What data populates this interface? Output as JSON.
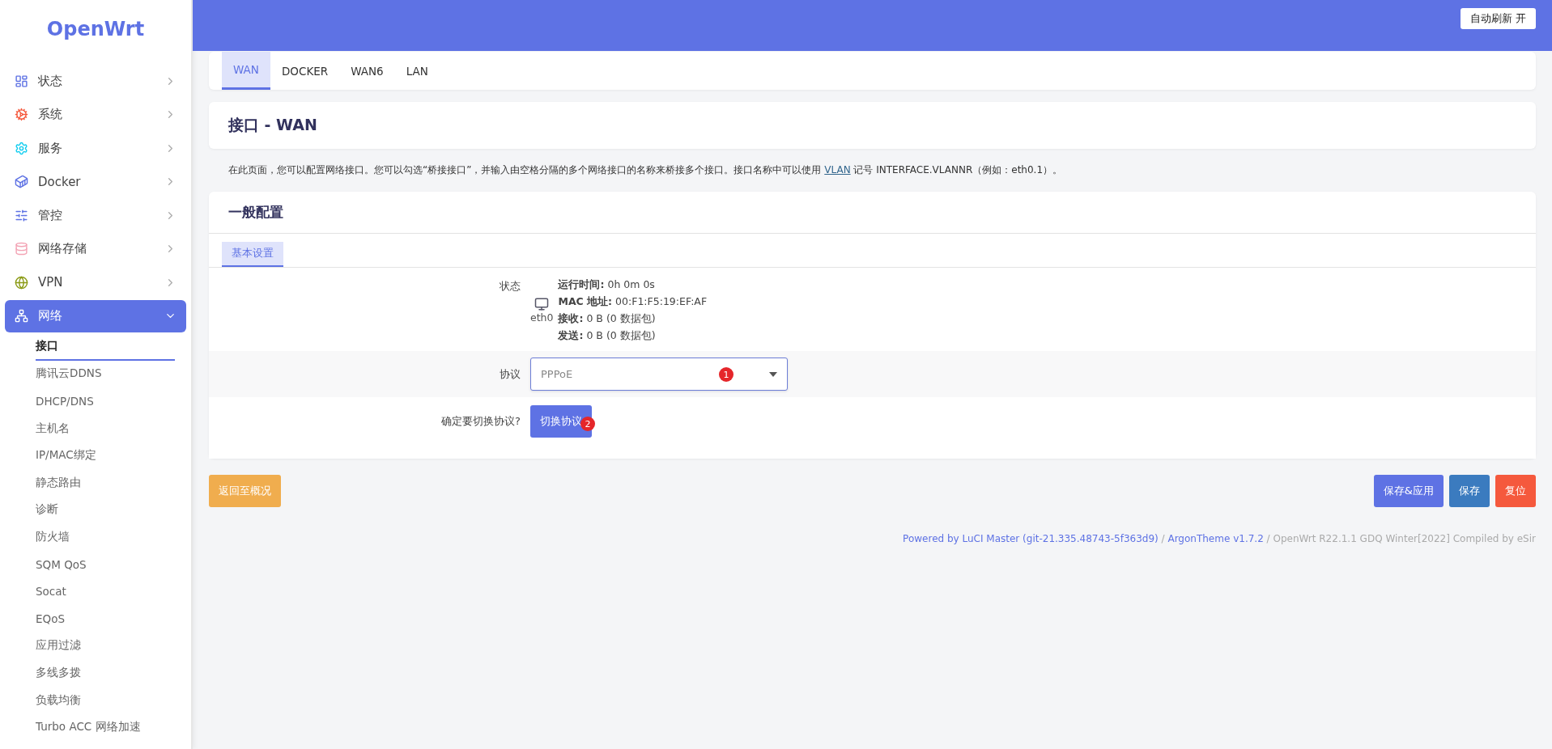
{
  "logo": "OpenWrt",
  "sidebar": {
    "items": [
      {
        "label": "状态",
        "selected": false,
        "expanded": false
      },
      {
        "label": "系统",
        "selected": false,
        "expanded": false
      },
      {
        "label": "服务",
        "selected": false,
        "expanded": false
      },
      {
        "label": "Docker",
        "selected": false,
        "expanded": false
      },
      {
        "label": "管控",
        "selected": false,
        "expanded": false
      },
      {
        "label": "网络存储",
        "selected": false,
        "expanded": false
      },
      {
        "label": "VPN",
        "selected": false,
        "expanded": false
      },
      {
        "label": "网络",
        "selected": true,
        "expanded": true,
        "children": [
          {
            "label": "接口",
            "selected": true
          },
          {
            "label": "腾讯云DDNS",
            "selected": false
          },
          {
            "label": "DHCP/DNS",
            "selected": false
          },
          {
            "label": "主机名",
            "selected": false
          },
          {
            "label": "IP/MAC绑定",
            "selected": false
          },
          {
            "label": "静态路由",
            "selected": false
          },
          {
            "label": "诊断",
            "selected": false
          },
          {
            "label": "防火墙",
            "selected": false
          },
          {
            "label": "SQM QoS",
            "selected": false
          },
          {
            "label": "Socat",
            "selected": false
          },
          {
            "label": "EQoS",
            "selected": false
          },
          {
            "label": "应用过滤",
            "selected": false
          },
          {
            "label": "多线多拨",
            "selected": false
          },
          {
            "label": "负载均衡",
            "selected": false
          },
          {
            "label": "Turbo ACC 网络加速",
            "selected": false
          }
        ]
      }
    ]
  },
  "header": {
    "refresh_button": "自动刷新 开"
  },
  "tabs": [
    {
      "label": "WAN",
      "selected": true
    },
    {
      "label": "DOCKER",
      "selected": false
    },
    {
      "label": "WAN6",
      "selected": false
    },
    {
      "label": "LAN",
      "selected": false
    }
  ],
  "page_title": "接口 - WAN",
  "description": {
    "text": "在此页面，您可以配置网络接口。您可以勾选“桥接接口”，并输入由空格分隔的多个网络接口的名称来桥接多个接口。接口名称中可以使用 ",
    "link": "VLAN",
    "after": " 记号 INTERFACE.VLANNR（例如：eth0.1）。"
  },
  "section": {
    "title": "一般配置",
    "subtabs": [
      {
        "label": "基本设置",
        "selected": true
      }
    ],
    "status": {
      "label": "状态",
      "device": "eth0",
      "lines": [
        {
          "key": "运行时间:",
          "value": " 0h 0m 0s"
        },
        {
          "key": "MAC 地址:",
          "value": " 00:F1:F5:19:EF:AF"
        },
        {
          "key": "接收:",
          "value": " 0 B (0 数据包)"
        },
        {
          "key": "发送:",
          "value": " 0 B (0 数据包)"
        }
      ]
    },
    "protocol": {
      "label": "协议",
      "value": "PPPoE",
      "badge": "1"
    },
    "switch": {
      "label": "确定要切换协议?",
      "button": "切换协议",
      "badge": "2"
    }
  },
  "actions": {
    "back": "返回至概况",
    "buttons": [
      {
        "label": "保存&应用",
        "kind": "primary"
      },
      {
        "label": "保存",
        "kind": "save"
      },
      {
        "label": "复位",
        "kind": "danger"
      }
    ]
  },
  "footer": {
    "powered": "Powered by LuCI Master (git-21.335.48743-5f363d9)",
    "sep": " / ",
    "theme": "ArgonTheme v1.7.2",
    "build": " / OpenWrt R22.1.1 GDQ Winter[2022] Compiled by eSir"
  }
}
